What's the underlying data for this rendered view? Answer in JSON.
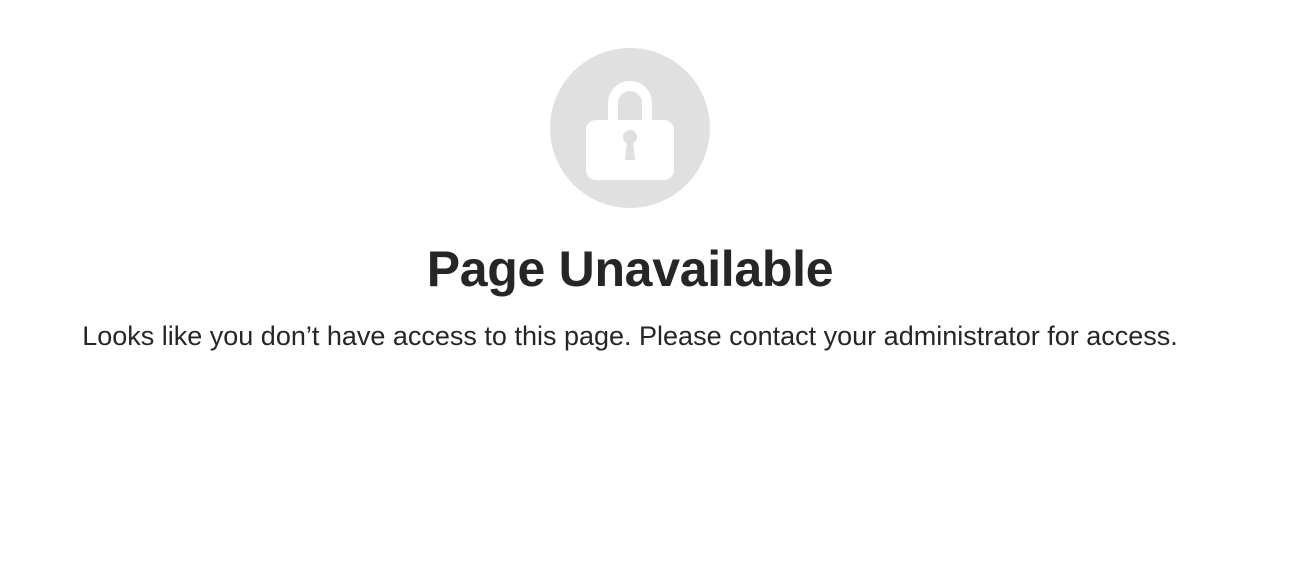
{
  "icon": {
    "name": "lock-icon",
    "background_color": "#e0e0e0",
    "foreground_color": "#ffffff"
  },
  "title": "Page Unavailable",
  "message": "Looks like you don’t have access to this page. Please contact your administrator for access.",
  "colors": {
    "text": "#262626",
    "background": "#ffffff"
  }
}
